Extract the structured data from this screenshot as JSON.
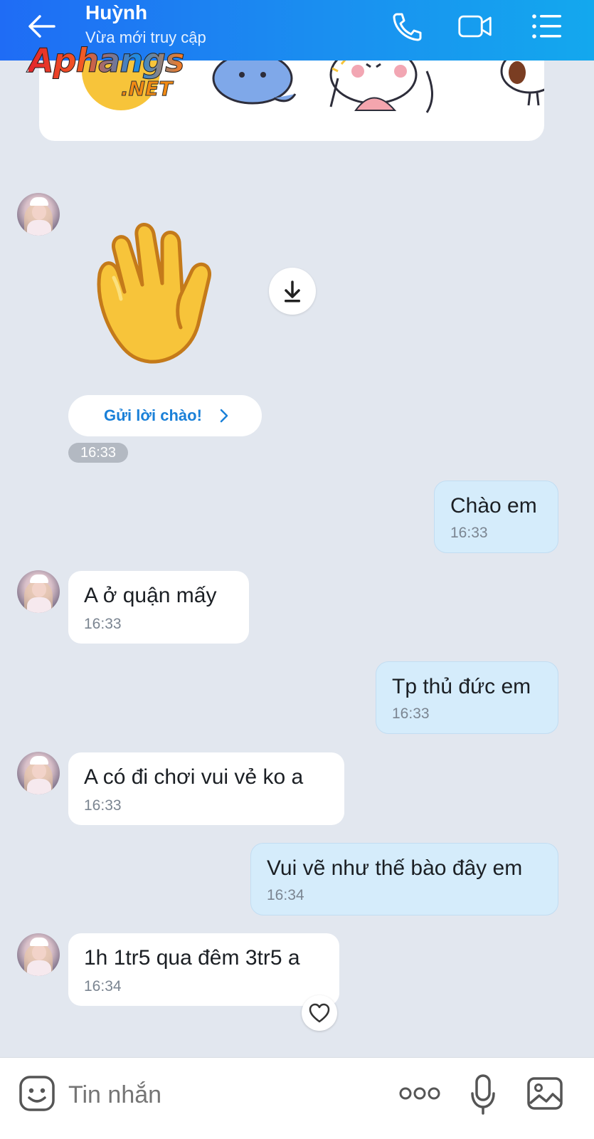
{
  "header": {
    "title": "Huỳnh",
    "subtitle": "Vừa mới truy cập"
  },
  "watermark": {
    "main": "Aphangs",
    "sub": ".NET"
  },
  "greet": {
    "label": "Gửi lời chào!",
    "time": "16:33"
  },
  "messages": [
    {
      "dir": "out",
      "text": "Chào em",
      "time": "16:33"
    },
    {
      "dir": "in",
      "text": "A ở quận mấy",
      "time": "16:33"
    },
    {
      "dir": "out",
      "text": "Tp thủ đức em",
      "time": "16:33"
    },
    {
      "dir": "in",
      "text": "A có đi chơi vui vẻ ko a",
      "time": "16:33"
    },
    {
      "dir": "out",
      "text": "Vui vẽ như thế bào đây em",
      "time": "16:34"
    },
    {
      "dir": "in",
      "text": "1h 1tr5 qua đêm 3tr5 a",
      "time": "16:34"
    }
  ],
  "composer": {
    "placeholder": "Tin nhắn"
  },
  "colors": {
    "header_start": "#1f6cf5",
    "header_end": "#13a8ee",
    "incoming_bubble": "#ffffff",
    "outgoing_bubble": "#d5ecfb",
    "background": "#e2e7ef",
    "link_blue": "#1a80d8"
  },
  "icons": [
    "back-arrow-icon",
    "phone-icon",
    "video-call-icon",
    "menu-list-icon",
    "download-icon",
    "chevron-right-icon",
    "heart-icon",
    "emoji-icon",
    "more-dots-icon",
    "microphone-icon",
    "image-icon"
  ]
}
